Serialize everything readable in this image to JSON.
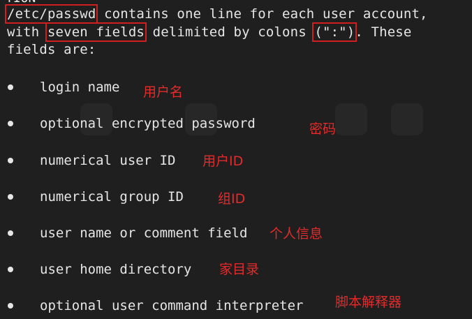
{
  "header": {
    "fragment": "TION"
  },
  "intro": {
    "line1_part1": "/etc/passwd",
    "line1_part2": " contains one line for each user account,",
    "line2_part1": "with ",
    "line2_part2": "seven fields",
    "line2_part3": " delimited by colons ",
    "line2_part4": "(\":\")",
    "line2_part5": ". These",
    "line3": "fields are:"
  },
  "fields": [
    {
      "label": "login name",
      "note": "用户名"
    },
    {
      "label": "optional encrypted password",
      "note": "密码"
    },
    {
      "label": "numerical user ID",
      "note": "用户ID"
    },
    {
      "label": "numerical group ID",
      "note": "组ID"
    },
    {
      "label": "user name or comment field",
      "note": "个人信息"
    },
    {
      "label": "user home directory",
      "note": "家目录"
    },
    {
      "label": "optional user command interpreter",
      "note": "脚本解释器"
    }
  ]
}
